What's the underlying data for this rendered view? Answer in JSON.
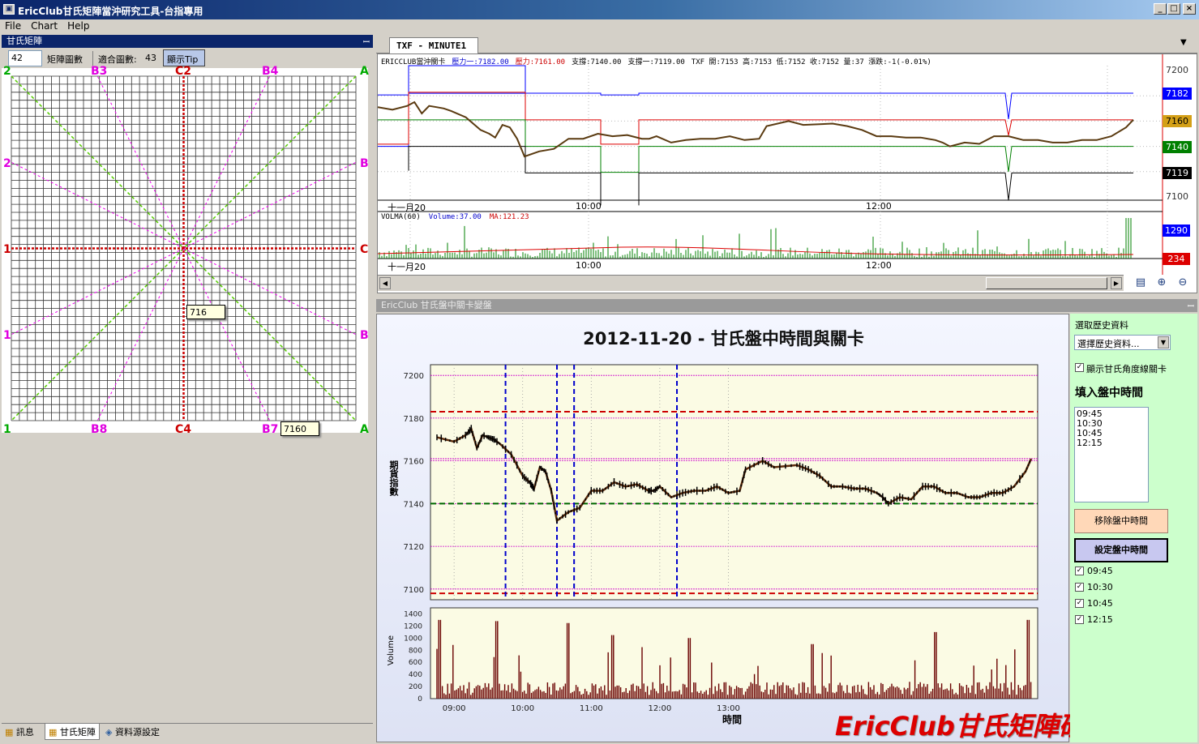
{
  "window": {
    "title": "EricClub甘氏矩陣當沖研究工具-台指專用"
  },
  "menu": [
    "File",
    "Chart",
    "Help"
  ],
  "left_panel": {
    "title": "甘氏矩陣",
    "matrix_input": "42",
    "matrix_label": "矩陣圖數",
    "fit_label": "適合圖數:",
    "fit_value": "43",
    "tip_button": "顯示Tip",
    "tooltip1": "716",
    "tooltip2": "7160",
    "labels": {
      "top": [
        "B3",
        "C2",
        "B4"
      ],
      "bottom": [
        "B8",
        "C4",
        "B7"
      ],
      "left": [
        "2",
        "1",
        "1"
      ],
      "right": [
        "B",
        "C",
        "B"
      ],
      "corners_left": [
        "2",
        "1"
      ],
      "corners_right": [
        "A",
        "A"
      ]
    }
  },
  "bottom_tabs": [
    "訊息",
    "甘氏矩陣",
    "資料源設定"
  ],
  "chart_tab": "TXF - MINUTE1",
  "top_chart": {
    "info": [
      {
        "t": "ERICCLUB當沖關卡",
        "c": "#000"
      },
      {
        "t": "壓力一:7182.00",
        "c": "#0000cc"
      },
      {
        "t": "壓力:7161.00",
        "c": "#cc0000"
      },
      {
        "t": "支撐:7140.00",
        "c": "#000"
      },
      {
        "t": "支撐一:7119.00",
        "c": "#000"
      },
      {
        "t": "TXF 開:7153 高:7153 低:7152 收:7152 量:37 漲跌:-1(-0.01%)",
        "c": "#000"
      }
    ],
    "y_ticks": [
      "7200",
      "7180",
      "7160",
      "7140",
      "7120",
      "7100"
    ],
    "badges": [
      {
        "v": "7182",
        "bg": "#0000ff",
        "fg": "#fff"
      },
      {
        "v": "7160",
        "bg": "#d4a017",
        "fg": "#000"
      },
      {
        "v": "7140",
        "bg": "#008000",
        "fg": "#fff"
      },
      {
        "v": "7119",
        "bg": "#000",
        "fg": "#fff"
      }
    ],
    "x_labels": [
      "十一月20",
      "10:00",
      "12:00"
    ],
    "vol_info": [
      {
        "t": "VOLMA(60)",
        "c": "#000"
      },
      {
        "t": "Volume:37.00",
        "c": "#0000cc"
      },
      {
        "t": "MA:121.23",
        "c": "#cc0000"
      }
    ],
    "vol_badges": [
      {
        "v": "1290",
        "bg": "#0000ff"
      },
      {
        "v": "234",
        "bg": "#dd0000"
      }
    ]
  },
  "lower_panel": {
    "title": "EricClub 甘氏盤中關卡變盤"
  },
  "main_chart": {
    "title": "2012-11-20  - 甘氏盤中時間與關卡"
  },
  "chart_data": {
    "type": "line",
    "title": "2012-11-20  - 甘氏盤中時間與關卡",
    "ylabel": "期貨指數",
    "xlabel": "時間",
    "ylim": [
      7095,
      7205
    ],
    "y_ticks": [
      "7200",
      "7180",
      "7160",
      "7140",
      "7120",
      "7100"
    ],
    "x_ticks": [
      "09:00",
      "10:00",
      "11:00",
      "12:00",
      "13:00"
    ],
    "price_path": {
      "time_min": [
        525,
        540,
        550,
        555,
        560,
        565,
        570,
        575,
        580,
        590,
        600,
        606,
        610,
        615,
        620,
        625,
        630,
        640,
        650,
        660,
        670,
        680,
        690,
        700,
        710,
        715,
        720,
        730,
        740,
        750,
        760,
        770,
        780,
        790,
        795,
        810,
        820,
        840,
        850,
        860,
        870,
        880,
        890,
        900,
        910,
        915,
        920,
        930,
        940,
        950,
        960,
        970,
        980,
        990,
        1000,
        1010,
        1020,
        1030,
        1040,
        1045
      ],
      "price": [
        7171,
        7169,
        7172,
        7175,
        7166,
        7172,
        7171,
        7170,
        7168,
        7163,
        7153,
        7150,
        7147,
        7157,
        7155,
        7146,
        7132,
        7136,
        7138,
        7146,
        7146,
        7150,
        7148,
        7149,
        7146,
        7146,
        7148,
        7143,
        7145,
        7146,
        7146,
        7148,
        7145,
        7146,
        7156,
        7160,
        7157,
        7158,
        7156,
        7153,
        7148,
        7148,
        7147,
        7147,
        7145,
        7143,
        7140,
        7143,
        7142,
        7148,
        7148,
        7145,
        7145,
        7143,
        7143,
        7145,
        7145,
        7148,
        7155,
        7161
      ]
    },
    "resistance_upper": 7183,
    "resistance": 7161,
    "support": 7140,
    "support_lower": 7098,
    "time_marks": [
      "09:45",
      "10:30",
      "10:45",
      "12:15"
    ],
    "volume": {
      "ylabel": "Volume",
      "ylim": [
        0,
        1500
      ],
      "y_ticks": [
        "1400",
        "1200",
        "1000",
        "800",
        "600",
        "400",
        "200",
        "0"
      ],
      "peak_values": [
        1300,
        1280,
        1250,
        1100,
        1050,
        1000,
        900,
        1300
      ]
    }
  },
  "side_panel": {
    "history_label": "選取歷史資料",
    "history_select": "選擇歷史資料...",
    "show_gann": "顯示甘氏角度線關卡",
    "input_title": "填入盤中時間",
    "times": [
      "09:45",
      "10:30",
      "10:45",
      "12:15"
    ],
    "remove_btn": "移除盤中時間",
    "set_btn": "設定盤中時間",
    "checks": [
      "09:45",
      "10:30",
      "10:45",
      "12:15"
    ]
  },
  "watermark": "EricClub甘氏矩陣研究工具"
}
